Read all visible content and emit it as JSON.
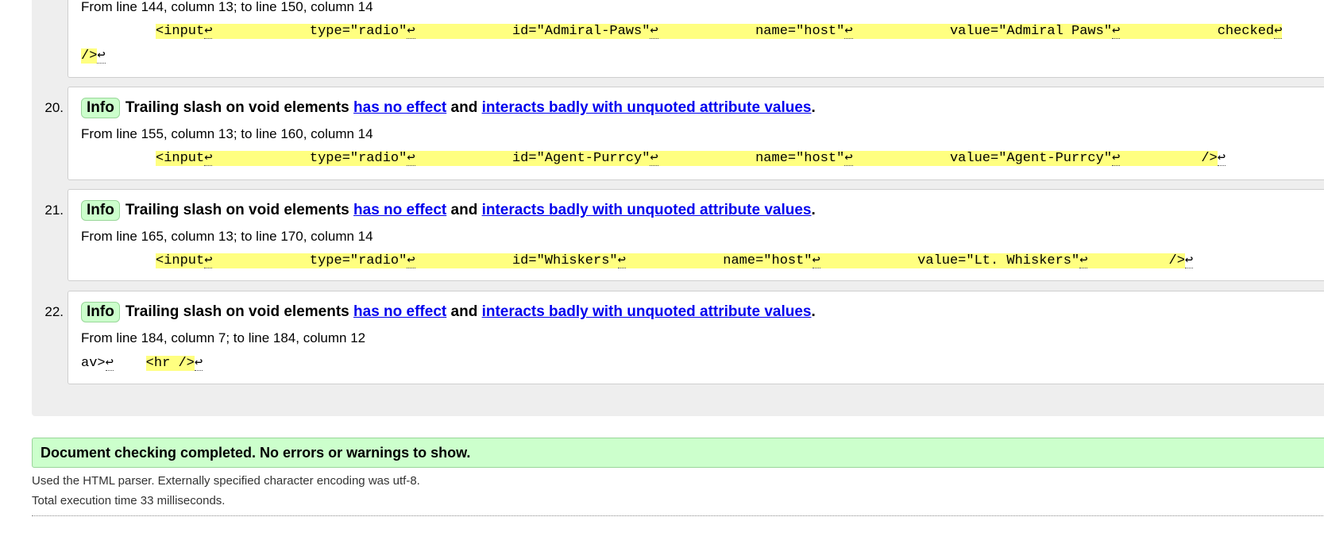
{
  "messages": [
    {
      "location": "From line 144, column 13; to line 150, column 14",
      "extract": {
        "line1": [
          "<input",
          "type=\"radio\"",
          "id=\"Admiral-Paws\"",
          "name=\"host\"",
          "value=\"Admiral Paws\"",
          "checked"
        ],
        "line2": "/>"
      }
    },
    {
      "number": "20.",
      "type": "Info",
      "text_prefix": "Trailing slash on void elements",
      "link1": "has no effect",
      "text_mid": "and",
      "link2": "interacts badly with unquoted attribute values",
      "text_suffix": ".",
      "location": "From line 155, column 13; to line 160, column 14",
      "extract": [
        "<input",
        "type=\"radio\"",
        "id=\"Agent-Purrcy\"",
        "name=\"host\"",
        "value=\"Agent-Purrcy\"",
        "/>"
      ]
    },
    {
      "number": "21.",
      "type": "Info",
      "text_prefix": "Trailing slash on void elements",
      "link1": "has no effect",
      "text_mid": "and",
      "link2": "interacts badly with unquoted attribute values",
      "text_suffix": ".",
      "location": "From line 165, column 13; to line 170, column 14",
      "extract": [
        "<input",
        "type=\"radio\"",
        "id=\"Whiskers\"",
        "name=\"host\"",
        "value=\"Lt. Whiskers\"",
        "/>"
      ]
    },
    {
      "number": "22.",
      "type": "Info",
      "text_prefix": "Trailing slash on void elements",
      "link1": "has no effect",
      "text_mid": "and",
      "link2": "interacts badly with unquoted attribute values",
      "text_suffix": ".",
      "location": "From line 184, column 7; to line 184, column 12",
      "extract": {
        "before": "av>",
        "highlight": "<hr />"
      }
    }
  ],
  "linefeed_symbol": "↩",
  "summary": "Document checking completed. No errors or warnings to show.",
  "footer": {
    "parser_note": "Used the HTML parser. Externally specified character encoding was utf-8.",
    "timing": "Total execution time 33 milliseconds."
  }
}
